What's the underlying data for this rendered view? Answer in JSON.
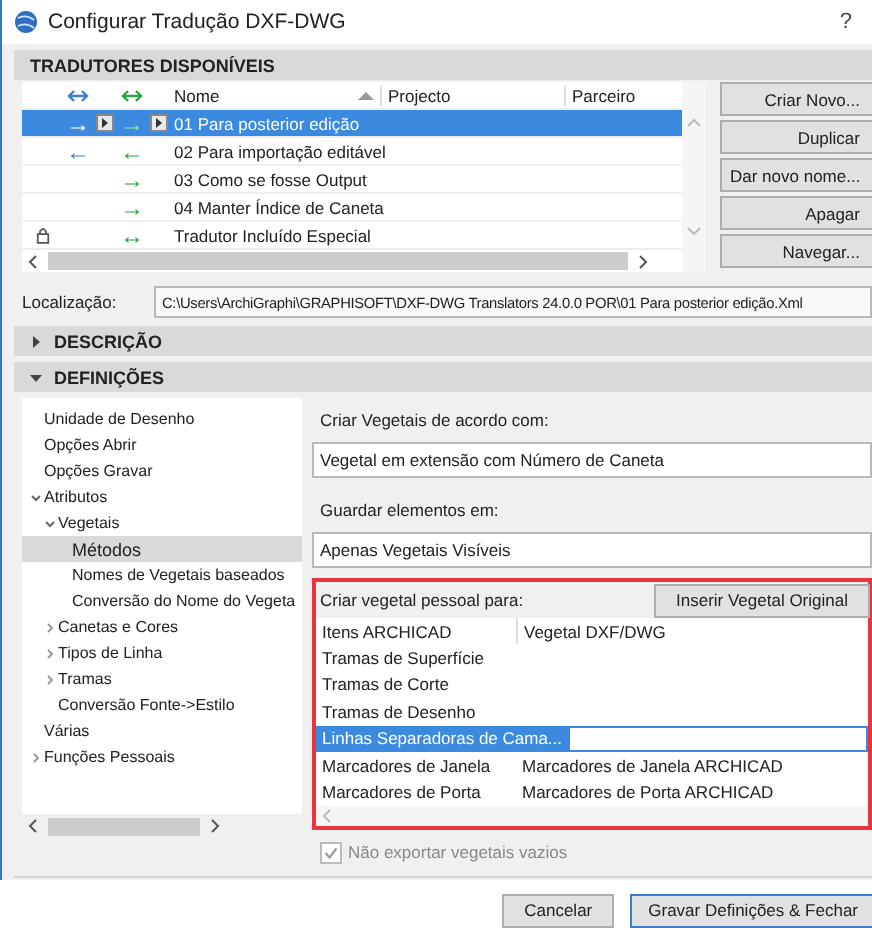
{
  "window": {
    "title": "Configurar Tradução DXF-DWG",
    "help": "?"
  },
  "translators": {
    "title": "TRADUTORES DISPONÍVEIS",
    "columns": [
      "Nome",
      "Projecto",
      "Parceiro"
    ],
    "rows": [
      {
        "name": "01 Para posterior edição",
        "selected": true,
        "project_arrow": "→",
        "partner_arrow": "→",
        "locked": false
      },
      {
        "name": "02 Para importação editável",
        "selected": false,
        "project_arrow": "←",
        "partner_arrow": "←",
        "locked": false
      },
      {
        "name": "03 Como se fosse Output",
        "selected": false,
        "partner_arrow": "→",
        "locked": false
      },
      {
        "name": "04 Manter Índice de Caneta",
        "selected": false,
        "partner_arrow": "→",
        "locked": false
      },
      {
        "name": "Tradutor Incluído Especial",
        "selected": false,
        "partner_arrow": "↔",
        "locked": true
      }
    ],
    "buttons": [
      "Criar Novo...",
      "Duplicar",
      "Dar novo nome...",
      "Apagar",
      "Navegar..."
    ]
  },
  "location": {
    "label": "Localização:",
    "value": "C:\\Users\\ArchiGraphi\\GRAPHISOFT\\DXF-DWG Translators 24.0.0 POR\\01 Para posterior edição.Xml"
  },
  "sections": [
    {
      "title": "DESCRIÇÃO",
      "expanded": false
    },
    {
      "title": "DEFINIÇÕES",
      "expanded": true
    }
  ],
  "tree": [
    {
      "label": "Unidade de Desenho",
      "selected": false
    },
    {
      "label": "Opções Abrir",
      "selected": false
    },
    {
      "label": "Opções Gravar",
      "selected": false
    },
    {
      "label": "Atributos",
      "selected": false,
      "expanded": true,
      "children": [
        {
          "label": "Vegetais",
          "selected": false,
          "expanded": true,
          "children": [
            {
              "label": "Métodos",
              "selected": true
            },
            {
              "label": "Nomes de Vegetais baseados",
              "selected": false
            },
            {
              "label": "Conversão do Nome do Vegeta",
              "selected": false
            }
          ]
        },
        {
          "label": "Canetas e Cores",
          "selected": false,
          "expanded": false
        },
        {
          "label": "Tipos de Linha",
          "selected": false,
          "expanded": false
        },
        {
          "label": "Tramas",
          "selected": false,
          "expanded": false
        },
        {
          "label": "Conversão Fonte->Estilo",
          "selected": false
        }
      ]
    },
    {
      "label": "Várias",
      "selected": false
    },
    {
      "label": "Funções Pessoais",
      "selected": false,
      "expanded": false
    }
  ],
  "settings": {
    "create_label": "Criar Vegetais de acordo com:",
    "create_value": "Vegetal em extensão com Número de Caneta",
    "store_label": "Guardar elementos em:",
    "store_value": "Apenas Vegetais Visíveis",
    "custom": {
      "label": "Criar vegetal pessoal para:",
      "highlighted": true,
      "button": "Inserir Vegetal Original",
      "columns": [
        "Itens ARCHICAD",
        "Vegetal DXF/DWG"
      ],
      "rows": [
        {
          "item": "Tramas de Superfície",
          "selected": false
        },
        {
          "item": "Tramas de Corte",
          "selected": false
        },
        {
          "item": "Tramas de Desenho",
          "selected": false
        },
        {
          "item": "Linhas Separadoras de Cama...",
          "selected": true
        },
        {
          "item": "Marcadores de Janela",
          "value": "Marcadores de Janela ARCHICAD",
          "selected": false
        },
        {
          "item": "Marcadores de Porta",
          "value": "Marcadores de Porta ARCHICAD",
          "selected": false
        }
      ]
    },
    "skip_empty": {
      "label": "Não exportar vegetais vazios",
      "checked": true,
      "disabled": true
    }
  },
  "footer": {
    "buttons": [
      "Cancelar",
      "Gravar Definições & Fechar"
    ]
  }
}
